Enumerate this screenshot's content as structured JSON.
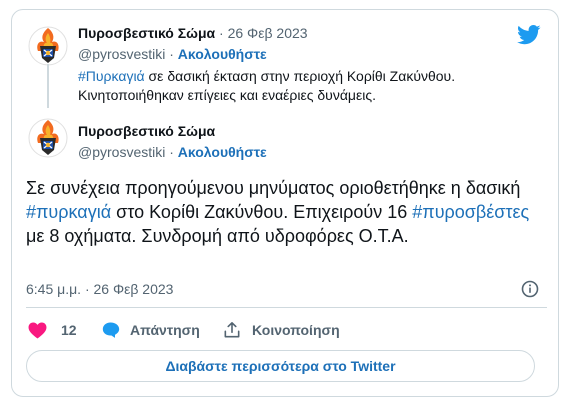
{
  "quoted": {
    "name": "Πυροσβεστικό Σώμα",
    "date": "26 Φεβ 2023",
    "handle": "@pyrosvestiki",
    "follow": "Ακολουθήστε",
    "hashtag": "#Πυρκαγιά",
    "text_line1": " σε δασική έκταση στην περιοχή Κορίθι Ζακύνθου.",
    "text_line2": "Κινητοποιήθηκαν επίγειες και εναέριες δυνάμεις."
  },
  "main": {
    "name": "Πυροσβεστικό Σώμα",
    "handle": "@pyrosvestiki",
    "follow": "Ακολουθήστε",
    "text_part1": "Σε συνέχεια προηγούμενου μηνύματος οριοθετήθηκε η δασική ",
    "hashtag1": "#πυρκαγιά",
    "text_part2": " στο Κορίθι Ζακύνθου. Επιχειρούν 16 ",
    "hashtag2": "#πυροσβέστες",
    "text_part3": " με 8 οχήματα. Συνδρομή από υδροφόρες Ο.Τ.Α.",
    "timestamp": "6:45 μ.μ. · 26 Φεβ 2023"
  },
  "actions": {
    "likes": "12",
    "reply_label": "Απάντηση",
    "share_label": "Κοινοποίηση"
  },
  "read_more": "Διαβάστε περισσότερα στο Twitter",
  "colors": {
    "link": "#1d70b8",
    "heart": "#f91880",
    "twitter_blue": "#1d9bf0",
    "border": "#cfd9de",
    "muted": "#536471"
  }
}
